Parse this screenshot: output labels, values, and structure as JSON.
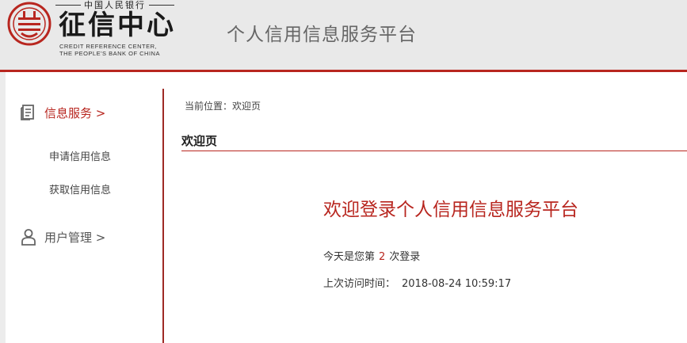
{
  "header": {
    "logo": {
      "top_text": "中国人民银行",
      "main_text": "征信中心",
      "en_line1": "CREDIT REFERENCE CENTER,",
      "en_line2": "THE PEOPLE'S BANK OF CHINA"
    },
    "platform_title": "个人信用信息服务平台"
  },
  "sidebar": {
    "groups": [
      {
        "label": "信息服务 >",
        "icon": "document-icon",
        "active": true,
        "items": [
          {
            "label": "申请信用信息"
          },
          {
            "label": "获取信用信息"
          }
        ]
      },
      {
        "label": "用户管理 >",
        "icon": "user-icon",
        "active": false,
        "items": []
      }
    ]
  },
  "main": {
    "breadcrumb": "当前位置：欢迎页",
    "section_title": "欢迎页",
    "welcome_heading": "欢迎登录个人信用信息服务平台",
    "login_count": {
      "prefix": "今天是您第",
      "count": "2",
      "suffix": "次登录"
    },
    "last_visit": {
      "label": "上次访问时间：",
      "time": "2018-08-24 10:59:17"
    }
  },
  "colors": {
    "accent": "#b8261f",
    "header_bg": "#e9e9e9"
  }
}
